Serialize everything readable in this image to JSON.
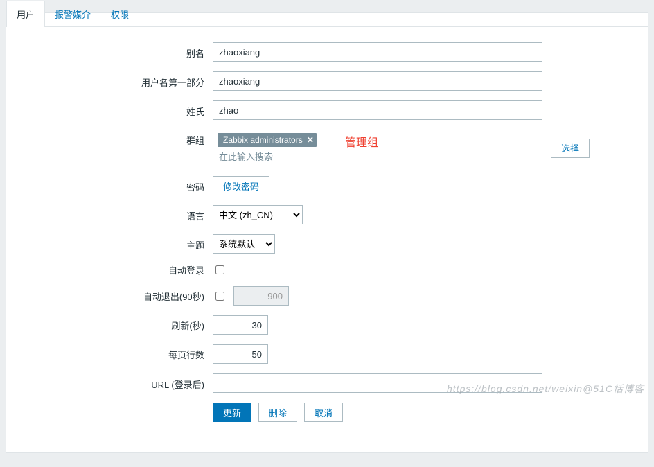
{
  "tabs": {
    "user": "用户",
    "media": "报警媒介",
    "perm": "权限"
  },
  "labels": {
    "alias": "别名",
    "name_first": "用户名第一部分",
    "surname": "姓氏",
    "groups": "群组",
    "password": "密码",
    "language": "语言",
    "theme": "主题",
    "autologin": "自动登录",
    "autologout": "自动退出(90秒)",
    "refresh": "刷新(秒)",
    "rows": "每页行数",
    "url": "URL (登录后)"
  },
  "fields": {
    "alias": "zhaoxiang",
    "name_first": "zhaoxiang",
    "surname": "zhao",
    "group_tag": "Zabbix administrators",
    "group_search_placeholder": "在此输入搜索",
    "password_btn": "修改密码",
    "language_selected": "中文 (zh_CN)",
    "theme_selected": "系统默认",
    "autologout_value": "900",
    "refresh_value": "30",
    "rows_value": "50",
    "url_value": ""
  },
  "buttons": {
    "select": "选择",
    "update": "更新",
    "delete": "删除",
    "cancel": "取消"
  },
  "annotation": "管理组",
  "icons": {
    "tag_close": "✕"
  },
  "watermark": "https://blog.csdn.net/weixin@51C恬博客"
}
